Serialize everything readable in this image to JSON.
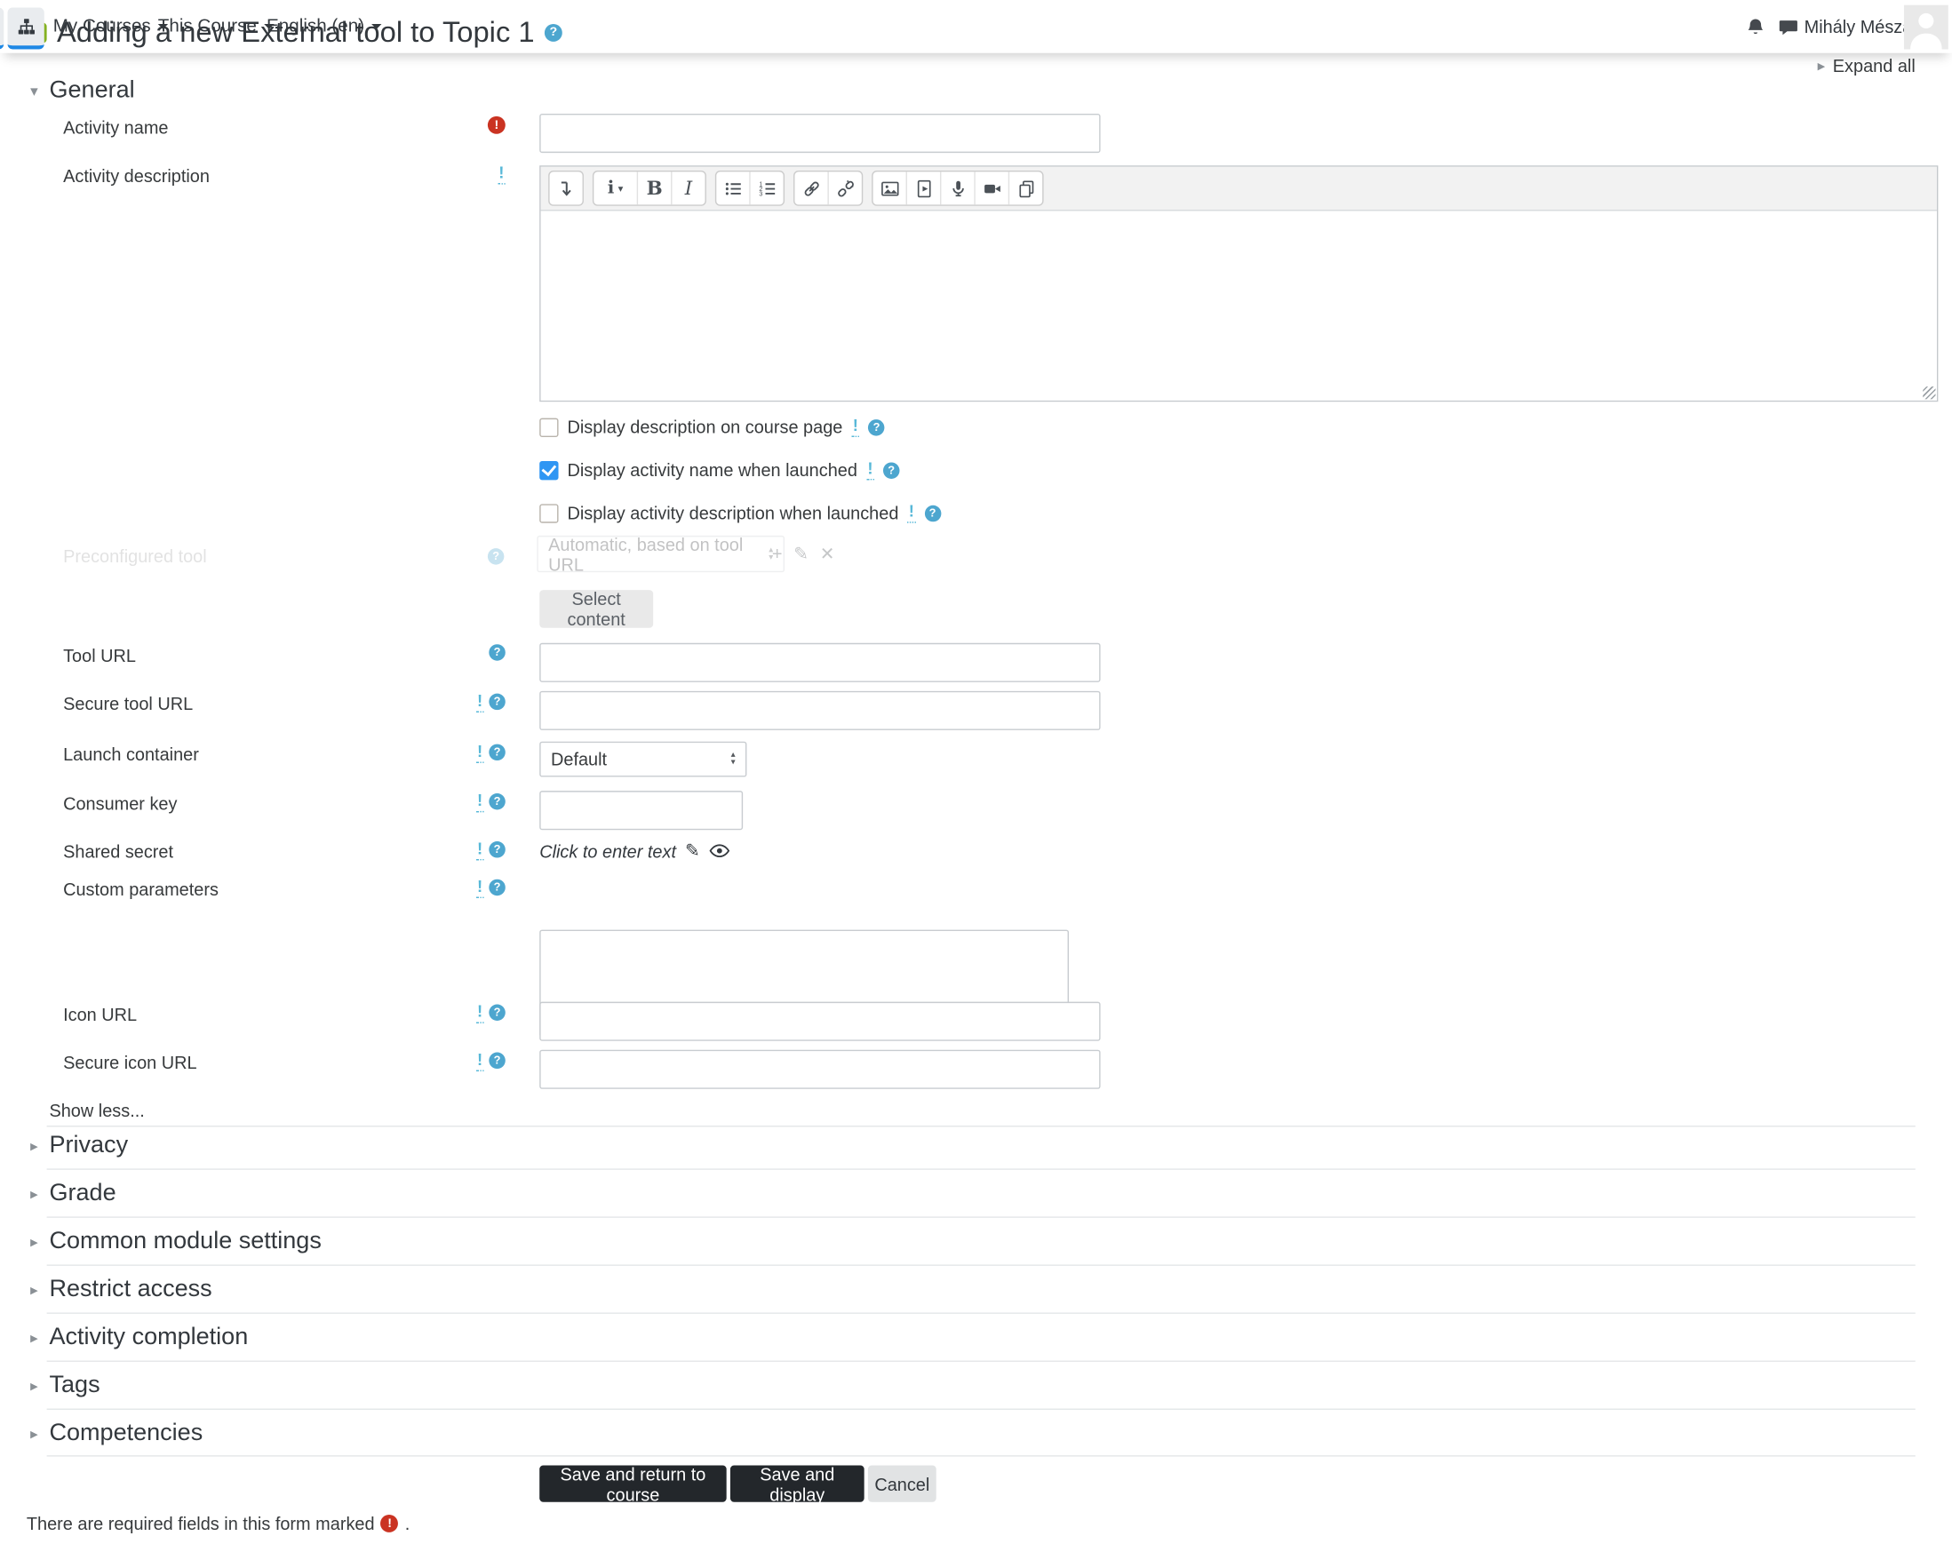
{
  "header": {
    "title": "Adding a new External tool to Topic 1",
    "tool_icon": "external-tool-icon",
    "help_icon": "help-icon",
    "expand_all": "Expand all"
  },
  "navbar": {
    "menus": [
      {
        "label": "My Courses"
      },
      {
        "label": "This Course"
      },
      {
        "label": "English (en)"
      }
    ],
    "icons": [
      "sitemap-icon",
      "bell-icon",
      "messages-icon"
    ],
    "user": {
      "name": "Mihály Mészáros"
    }
  },
  "sections": {
    "general": "General",
    "collapsed": [
      {
        "label": "Privacy"
      },
      {
        "label": "Grade"
      },
      {
        "label": "Common module settings"
      },
      {
        "label": "Restrict access"
      },
      {
        "label": "Activity completion"
      },
      {
        "label": "Tags"
      },
      {
        "label": "Competencies"
      }
    ]
  },
  "fields": {
    "activity_name": {
      "label": "Activity name",
      "value": "",
      "required": true
    },
    "activity_description": {
      "label": "Activity description",
      "value": ""
    },
    "display_description": {
      "label": "Display description on course page",
      "checked": false
    },
    "display_activity_name": {
      "label": "Display activity name when launched",
      "checked": true
    },
    "display_activity_description": {
      "label": "Display activity description when launched",
      "checked": false
    },
    "preconfigured_tool": {
      "label": "Preconfigured tool",
      "value": "Automatic, based on tool URL"
    },
    "select_content": {
      "label": "Select content"
    },
    "tool_url": {
      "label": "Tool URL",
      "value": ""
    },
    "secure_tool_url": {
      "label": "Secure tool URL",
      "value": ""
    },
    "launch_container": {
      "label": "Launch container",
      "value": "Default"
    },
    "consumer_key": {
      "label": "Consumer key",
      "value": ""
    },
    "shared_secret": {
      "label": "Shared secret",
      "value": "Click to enter text"
    },
    "custom_parameters": {
      "label": "Custom parameters",
      "value": ""
    },
    "icon_url": {
      "label": "Icon URL",
      "value": ""
    },
    "secure_icon_url": {
      "label": "Secure icon URL",
      "value": ""
    }
  },
  "editor_toolbar_icons": [
    "collapse-toolbar-icon",
    "paragraph-style-icon",
    "bold-icon",
    "italic-icon",
    "unordered-list-icon",
    "ordered-list-icon",
    "link-icon",
    "unlink-icon",
    "image-icon",
    "media-icon",
    "record-audio-icon",
    "record-video-icon",
    "manage-files-icon"
  ],
  "misc": {
    "show_less": "Show less...",
    "bold_glyph": "B",
    "italic_glyph": "I",
    "para_glyph": "i"
  },
  "buttons": {
    "save_return": "Save and return to course",
    "save_display": "Save and display",
    "cancel": "Cancel"
  },
  "footer": {
    "required_note": "There are required fields in this form marked",
    "suffix": "."
  },
  "colors": {
    "tool_green": "#84b221",
    "help_blue": "#4da6cf",
    "advanced_cyan": "#58b8d8",
    "required_red": "#ca3322",
    "checkbox_blue": "#2f96f3",
    "nav_active_blue": "#1e88e5",
    "dark_button": "#23272b"
  }
}
